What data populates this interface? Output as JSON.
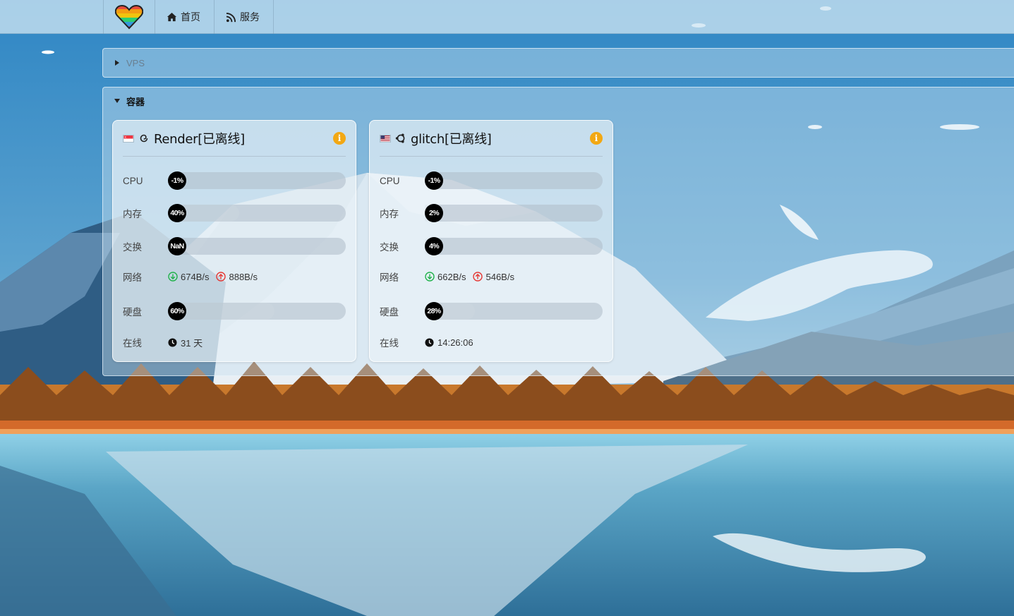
{
  "nav": {
    "home_label": "首页",
    "services_label": "服务"
  },
  "groups": {
    "vps_label": "VPS",
    "container_label": "容器"
  },
  "servers": [
    {
      "name": "Render[已离线]",
      "flag_country": "SG",
      "os_icon": "debian-icon",
      "cpu_label": "CPU",
      "cpu": "-1%",
      "mem_label": "内存",
      "mem": "40%",
      "swap_label": "交换",
      "swap": "NaN",
      "net_label": "网络",
      "net_down": "674B/s",
      "net_up": "888B/s",
      "disk_label": "硬盘",
      "disk": "60%",
      "uptime_label": "在线",
      "uptime": "31 天"
    },
    {
      "name": "glitch[已离线]",
      "flag_country": "US",
      "os_icon": "ubuntu-icon",
      "cpu_label": "CPU",
      "cpu": "-1%",
      "mem_label": "内存",
      "mem": "2%",
      "swap_label": "交换",
      "swap": "4%",
      "net_label": "网络",
      "net_down": "662B/s",
      "net_up": "546B/s",
      "disk_label": "硬盘",
      "disk": "28%",
      "uptime_label": "在线",
      "uptime": "14:26:06"
    }
  ],
  "colors": {
    "info": "#f2a814",
    "net_down": "#21b24b",
    "net_up": "#e53935",
    "badge": "#000000"
  }
}
